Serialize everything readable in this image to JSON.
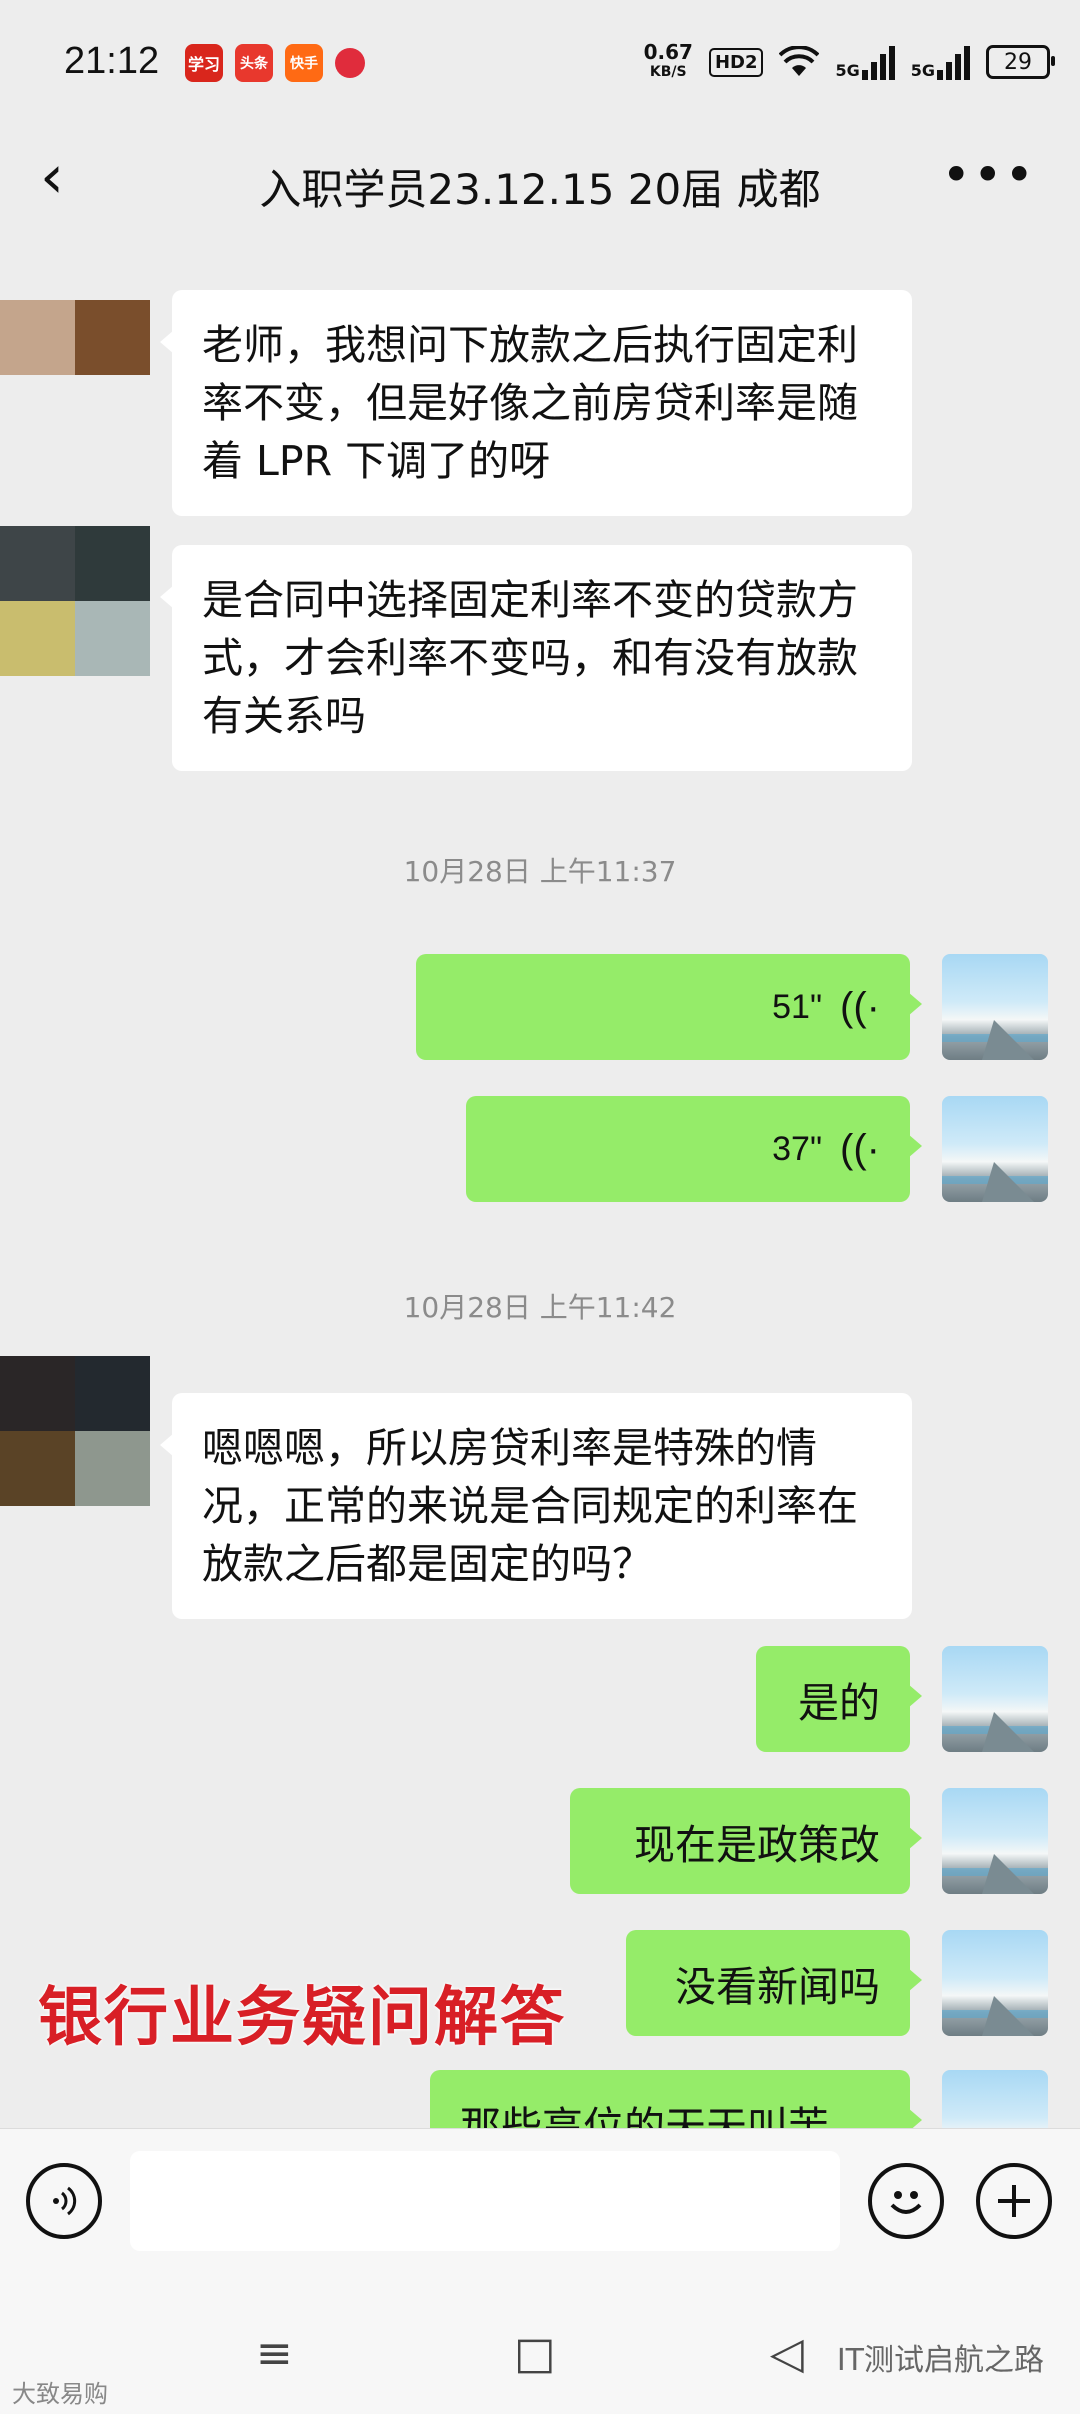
{
  "status_bar": {
    "time": "21:12",
    "speed_value": "0.67",
    "speed_unit": "KB/S",
    "hd_label": "HD2",
    "net1": "5G",
    "net2": "5G",
    "battery": "29",
    "app_icons": [
      "学习",
      "头条",
      "快手",
      "rec"
    ]
  },
  "header": {
    "back_icon": "chevron-left",
    "title": "入职学员23.12.15 20届 成都",
    "more_icon": "ellipsis"
  },
  "messages": [
    {
      "side": "left",
      "text": "老师，我想问下放款之后执行固定利率不变，但是好像之前房贷利率是随着 LPR 下调了的呀"
    },
    {
      "side": "left",
      "text": "是合同中选择固定利率不变的贷款方式，才会利率不变吗，和有没有放款有关系吗"
    },
    {
      "type": "timestamp",
      "text": "10月28日 上午11:37"
    },
    {
      "side": "right",
      "voice": "51\""
    },
    {
      "side": "right",
      "voice": "37\""
    },
    {
      "type": "timestamp",
      "text": "10月28日 上午11:42"
    },
    {
      "side": "left",
      "text": "嗯嗯嗯，所以房贷利率是特殊的情况，正常的来说是合同规定的利率在放款之后都是固定的吗？"
    },
    {
      "side": "right",
      "text": "是的"
    },
    {
      "side": "right",
      "text": "现在是政策改"
    },
    {
      "side": "right",
      "text": "没看新闻吗"
    },
    {
      "side": "right",
      "text": "那些高位的天天叫苦"
    }
  ],
  "overlay_caption": "银行业务疑问解答",
  "input_bar": {
    "voice_icon": "voice-toggle",
    "emoji_icon": "smiley",
    "plus_icon": "plus"
  },
  "nav_bar": {
    "menu_icon": "≡",
    "home_icon": "□",
    "back_icon": "◁"
  },
  "watermarks": {
    "right": "IT测试启航之路",
    "left": "大致易购"
  },
  "colors": {
    "chat_bg": "#ededed",
    "bubble_self": "#95ec69",
    "bubble_other": "#ffffff",
    "caption": "#d81f26"
  }
}
